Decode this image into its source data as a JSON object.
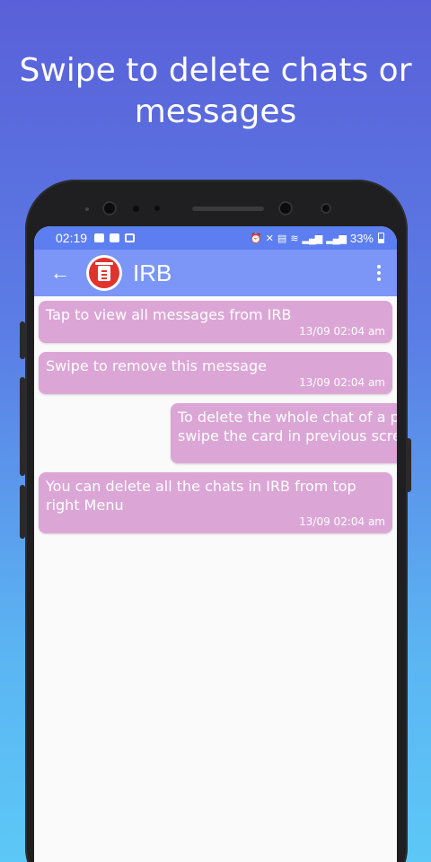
{
  "headline": "Swipe to delete chats or messages",
  "status_bar": {
    "time": "02:19",
    "battery": "33%"
  },
  "app_bar": {
    "title": "IRB",
    "back_icon": "arrow-left-icon",
    "avatar_icon": "trash-icon",
    "menu_icon": "more-vertical-icon"
  },
  "messages": [
    {
      "text": "Tap to view all messages from IRB",
      "time": "13/09 02:04 am"
    },
    {
      "text": "Swipe to remove this message",
      "time": "13/09 02:04 am"
    },
    {
      "text_line1": "To delete the whole chat of a pe",
      "text_line2": "swipe the card in previous scree"
    },
    {
      "text": "You can delete all the chats in IRB from top right Menu",
      "time": "13/09 02:04 am"
    }
  ],
  "colors": {
    "status_bar": "#5c7ef0",
    "app_bar": "#7b96f7",
    "bubble": "#dba6d6",
    "avatar": "#e0332d"
  }
}
